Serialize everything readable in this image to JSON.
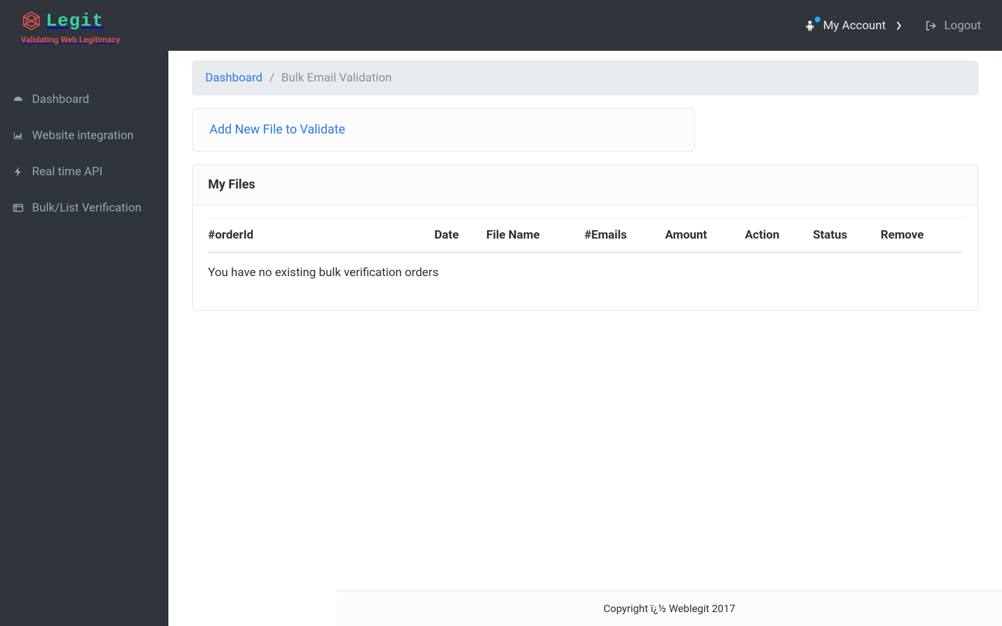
{
  "brand": {
    "name": "Legit",
    "tagline": "Validating Web Legitimacy"
  },
  "header": {
    "account_label": "My Account",
    "logout_label": "Logout"
  },
  "sidebar": {
    "items": [
      {
        "label": "Dashboard"
      },
      {
        "label": "Website integration"
      },
      {
        "label": "Real time API"
      },
      {
        "label": "Bulk/List Verification"
      }
    ]
  },
  "breadcrumb": {
    "root": "Dashboard",
    "sep": "/",
    "current": "Bulk Email Validation"
  },
  "add_file_link": "Add New File to Validate",
  "panel": {
    "title": "My Files",
    "columns": [
      "#orderId",
      "Date",
      "File Name",
      "#Emails",
      "Amount",
      "Action",
      "Status",
      "Remove"
    ],
    "empty_message": "You have no existing bulk verification orders"
  },
  "footer": "Copyright ï¿½ Weblegit 2017"
}
